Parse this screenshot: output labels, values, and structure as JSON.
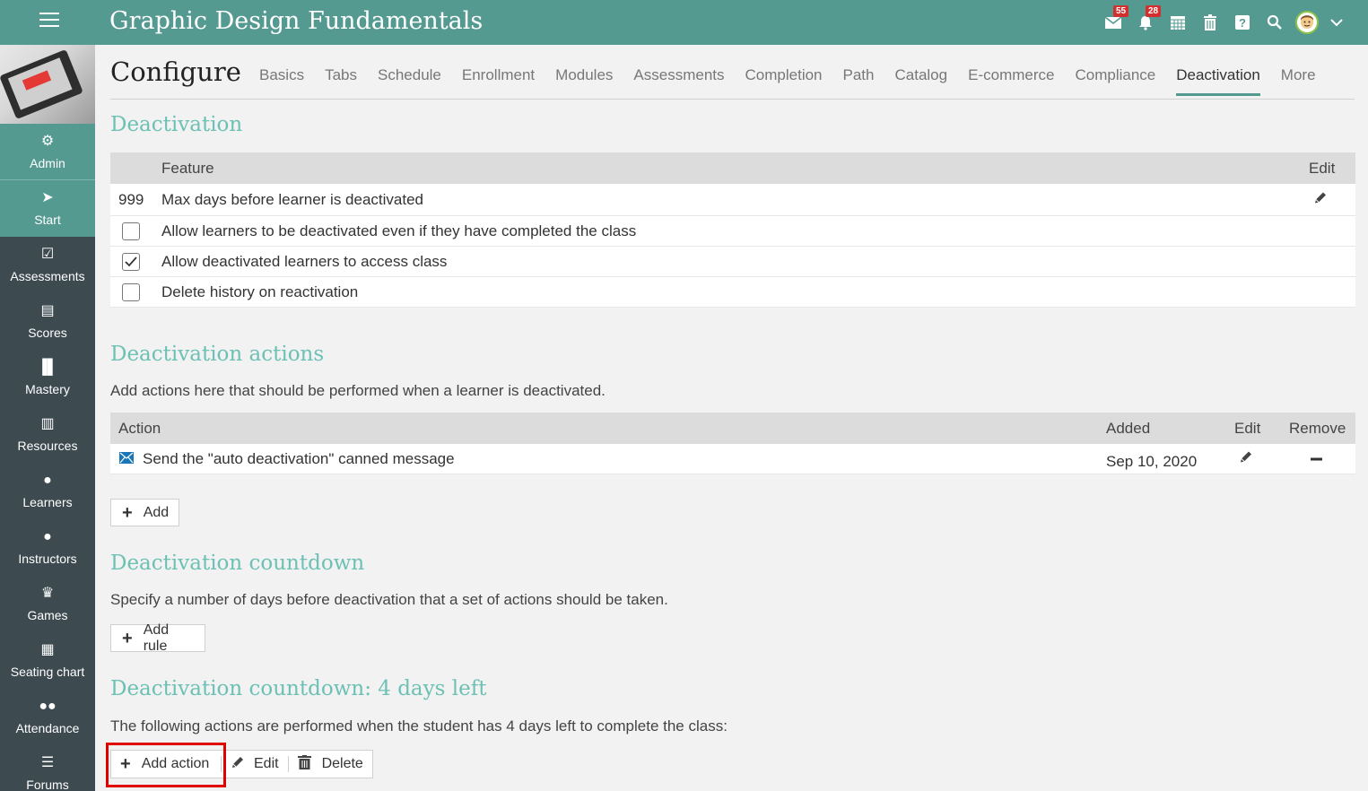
{
  "header": {
    "app_title": "Graphic Design Fundamentals",
    "mail_badge": "55",
    "notifications_badge": "28"
  },
  "sidebar": {
    "items": [
      {
        "label": "Admin",
        "icon": "gear-icon"
      },
      {
        "label": "Start",
        "icon": "navigation-arrow-icon"
      },
      {
        "label": "Assessments",
        "icon": "check-square-icon"
      },
      {
        "label": "Scores",
        "icon": "gradebook-icon"
      },
      {
        "label": "Mastery",
        "icon": "bar-chart-icon"
      },
      {
        "label": "Resources",
        "icon": "books-icon"
      },
      {
        "label": "Learners",
        "icon": "person-icon"
      },
      {
        "label": "Instructors",
        "icon": "instructor-icon"
      },
      {
        "label": "Games",
        "icon": "trophy-icon"
      },
      {
        "label": "Seating chart",
        "icon": "seating-grid-icon"
      },
      {
        "label": "Attendance",
        "icon": "people-group-icon"
      },
      {
        "label": "Forums",
        "icon": "list-icon"
      }
    ]
  },
  "page": {
    "title": "Configure",
    "tabs": [
      "Basics",
      "Tabs",
      "Schedule",
      "Enrollment",
      "Modules",
      "Assessments",
      "Completion",
      "Path",
      "Catalog",
      "E-commerce",
      "Compliance",
      "Deactivation",
      "More"
    ],
    "active_tab": "Deactivation"
  },
  "deactivation": {
    "heading": "Deactivation",
    "col_feature": "Feature",
    "col_edit": "Edit",
    "rows": [
      {
        "value": "999",
        "label": "Max days before learner is deactivated"
      },
      {
        "checked": false,
        "label": "Allow learners to be deactivated even if they have completed the class"
      },
      {
        "checked": true,
        "label": "Allow deactivated learners to access class"
      },
      {
        "checked": false,
        "label": "Delete history on reactivation"
      }
    ]
  },
  "actions": {
    "heading": "Deactivation actions",
    "description": "Add actions here that should be performed when a learner is deactivated.",
    "col_action": "Action",
    "col_added": "Added",
    "col_edit": "Edit",
    "col_remove": "Remove",
    "rows": [
      {
        "action": "Send the \"auto deactivation\" canned message",
        "added": "Sep 10, 2020"
      }
    ],
    "add_label": "Add"
  },
  "countdown": {
    "heading": "Deactivation countdown",
    "description": "Specify a number of days before deactivation that a set of actions should be taken.",
    "add_rule_label": "Add rule"
  },
  "countdown_rule": {
    "heading": "Deactivation countdown: 4 days left",
    "description": "The following actions are performed when the student has 4 days left to complete the class:",
    "add_action_label": "Add action",
    "edit_label": "Edit",
    "delete_label": "Delete"
  },
  "colors": {
    "brand": "#559a91",
    "heading": "#6cc1b4",
    "sidebar": "#3d4a50",
    "highlight": "#e00000"
  }
}
